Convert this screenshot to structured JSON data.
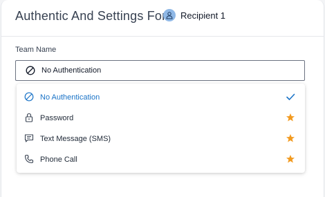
{
  "header": {
    "title": "Authentic And Settings For",
    "recipient": {
      "name": "Recipient 1",
      "avatar_icon": "user-icon"
    }
  },
  "field": {
    "label": "Team Name",
    "selected_value": "No Authentication",
    "selected_icon": "no-entry-icon"
  },
  "options": [
    {
      "label": "No Authentication",
      "icon": "no-entry-icon",
      "selected": true,
      "status_icon": "check-icon"
    },
    {
      "label": "Password",
      "icon": "lock-icon",
      "selected": false,
      "status_icon": "star-icon"
    },
    {
      "label": "Text Message (SMS)",
      "icon": "message-icon",
      "selected": false,
      "status_icon": "star-icon"
    },
    {
      "label": "Phone Call",
      "icon": "phone-icon",
      "selected": false,
      "status_icon": "star-icon"
    }
  ],
  "colors": {
    "accent": "#1a73c7",
    "star": "#f29a1f",
    "avatar_bg": "#8fb8e6"
  }
}
